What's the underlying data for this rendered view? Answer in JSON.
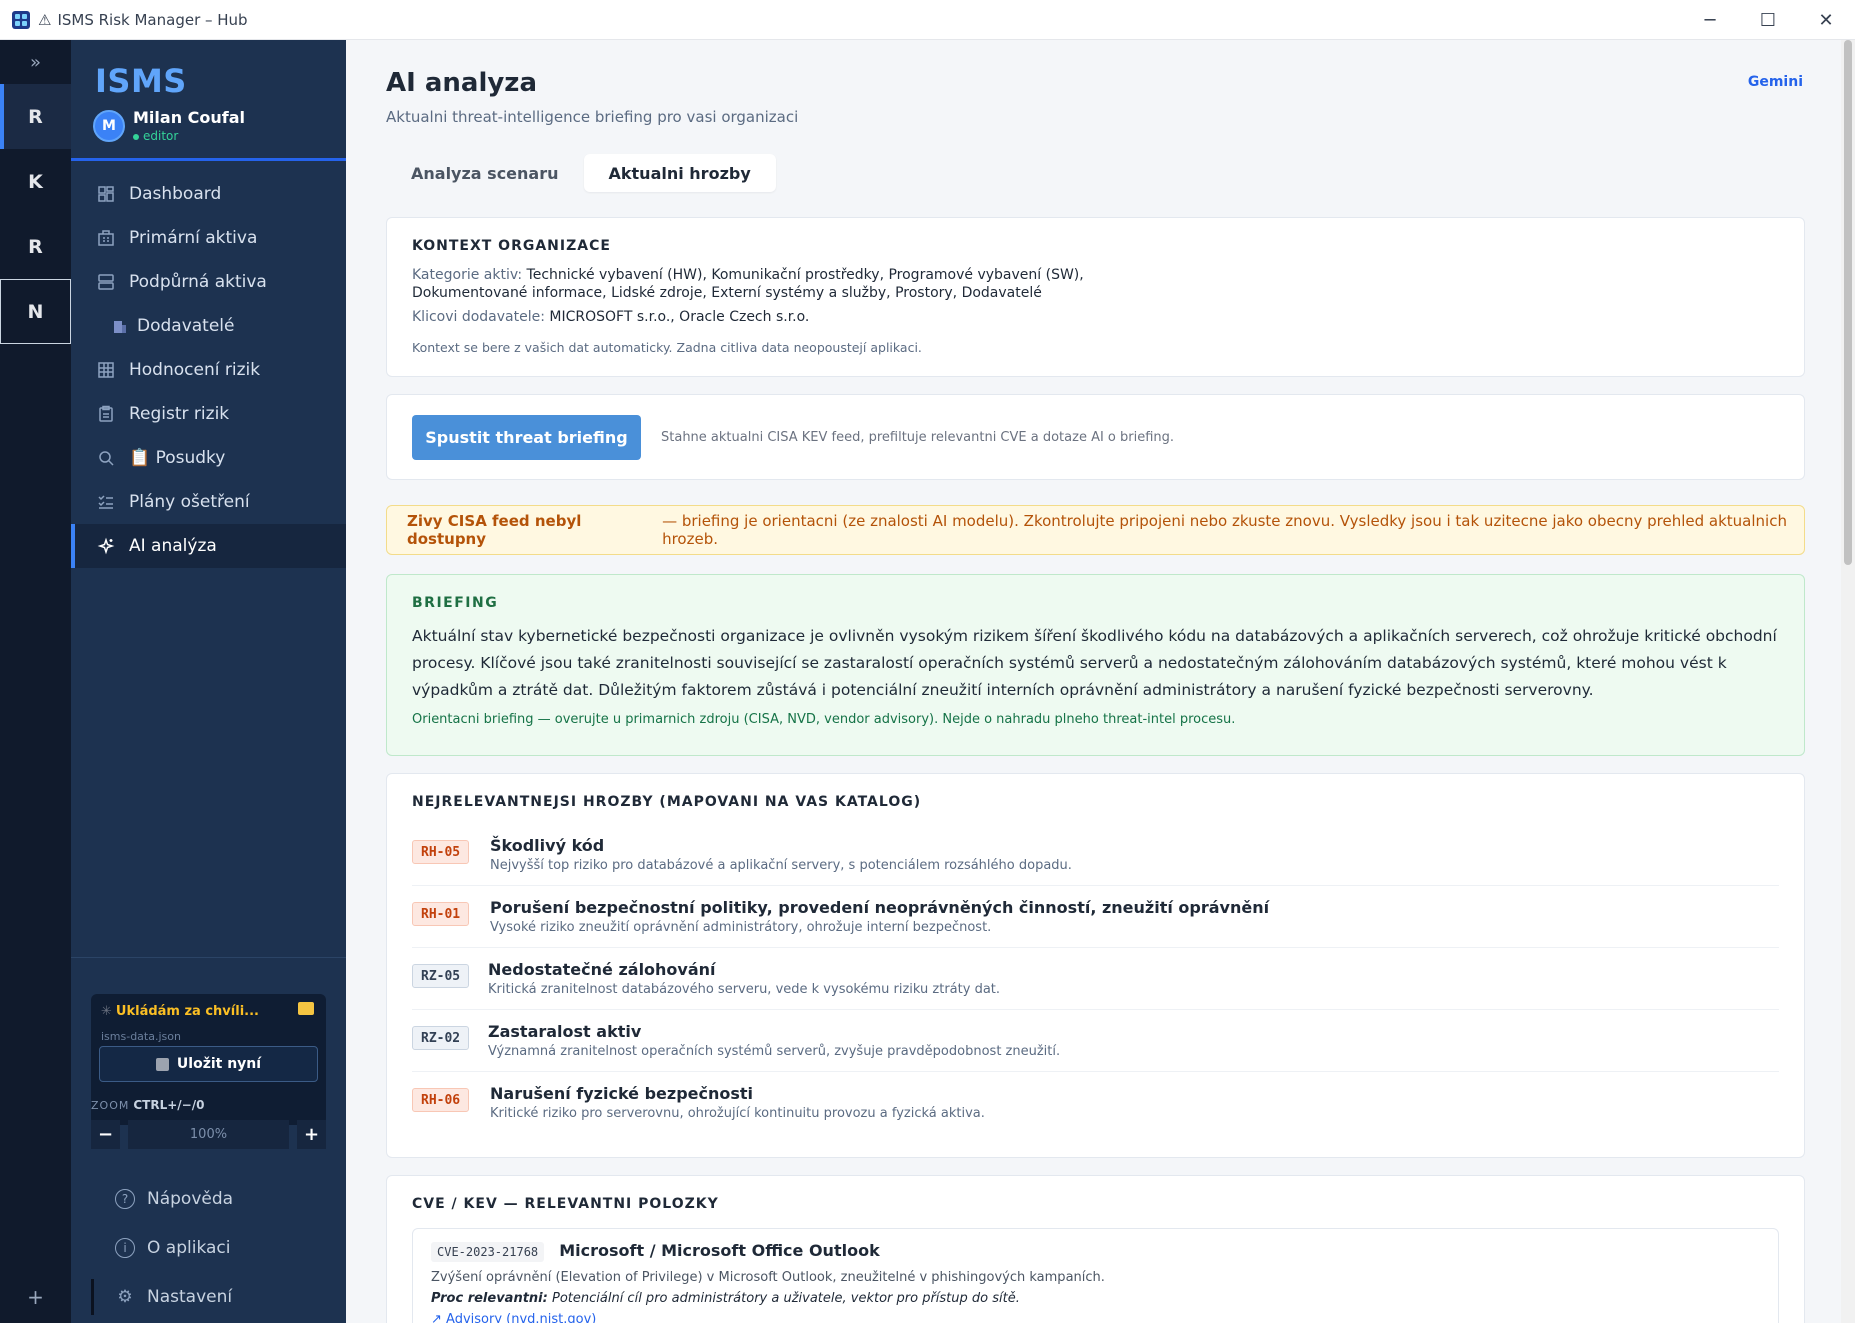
{
  "window": {
    "title": "ISMS Risk Manager – Hub",
    "minimize": "─",
    "maximize": "☐",
    "close": "✕"
  },
  "rail": {
    "expand": "»",
    "items": [
      "R",
      "K",
      "R",
      "N"
    ],
    "add": "+"
  },
  "sidebar": {
    "logo": "ISMS",
    "user": {
      "initial": "M",
      "name": "Milan Coufal",
      "role": "editor"
    },
    "nav": [
      {
        "label": "Dashboard",
        "icon": "dashboard-icon"
      },
      {
        "label": "Primární aktiva",
        "icon": "building-icon"
      },
      {
        "label": "Podpůrná aktiva",
        "icon": "server-icon"
      },
      {
        "label": "Dodavatelé",
        "icon": "supplier-icon"
      },
      {
        "label": "Hodnocení rizik",
        "icon": "grid-icon"
      },
      {
        "label": "Registr rizik",
        "icon": "clipboard-icon"
      },
      {
        "label": "📋 Posudky",
        "icon": "search-icon"
      },
      {
        "label": "Plány ošetření",
        "icon": "checklist-icon"
      },
      {
        "label": "AI analýza",
        "icon": "sparkle-icon"
      }
    ],
    "save": {
      "status": "Ukládám za chvíli...",
      "file": "isms-data.json",
      "button": "Uložit nyní"
    },
    "zoom": {
      "label": "ZOOM",
      "shortcut": "CTRL+/−/0",
      "value": "100%",
      "minus": "−",
      "plus": "+"
    },
    "bottom": [
      {
        "label": "Nápověda",
        "icon": "help-icon",
        "glyph": "?"
      },
      {
        "label": "O aplikaci",
        "icon": "info-icon",
        "glyph": "i"
      },
      {
        "label": "Nastavení",
        "icon": "gear-icon",
        "glyph": "⚙"
      }
    ]
  },
  "main": {
    "title": "AI analyza",
    "subtitle": "Aktualni threat-intelligence briefing pro vasi organizaci",
    "provider": "Gemini",
    "tabs": [
      "Analyza scenaru",
      "Aktualni hrozby"
    ],
    "context": {
      "heading": "KONTEXT ORGANIZACE",
      "categories_label": "Kategorie aktiv:",
      "categories_line1": "Technické vybavení (HW), Komunikační prostředky, Programové vybavení (SW),",
      "categories_line2": "Dokumentované informace, Lidské zdroje, Externí systémy a služby, Prostory, Dodavatelé",
      "suppliers_label": "Klicovi dodavatele:",
      "suppliers": "MICROSOFT s.r.o., Oracle Czech s.r.o.",
      "note": "Kontext se bere z vašich dat automaticky. Zadna citliva data neopoustejí aplikaci."
    },
    "run": {
      "button": "Spustit threat briefing",
      "hint": "Stahne aktualni CISA KEV feed, prefiltuje relevantni CVE a dotaze AI o briefing."
    },
    "warning": {
      "bold": "Zivy CISA feed nebyl dostupny",
      "text": "— briefing je orientacni (ze znalosti AI modelu). Zkontrolujte pripojeni nebo zkuste znovu. Vysledky jsou i tak uzitecne jako obecny prehled aktualnich hrozeb."
    },
    "briefing": {
      "heading": "BRIEFING",
      "text": "Aktuální stav kybernetické bezpečnosti organizace je ovlivněn vysokým rizikem šíření škodlivého kódu na databázových a aplikačních serverech, což ohrožuje kritické obchodní procesy. Klíčové jsou také zranitelnosti související se zastaralostí operačních systémů serverů a nedostatečným zálohováním databázových systémů, které mohou vést k výpadkům a ztrátě dat. Důležitým faktorem zůstává i potenciální zneužití interních oprávnění administrátory a narušení fyzické bezpečnosti serverovny.",
      "disclaimer": "Orientacni briefing — overujte u primarnich zdroju (CISA, NVD, vendor advisory). Nejde o nahradu plneho threat-intel procesu."
    },
    "threats": {
      "heading": "NEJRELEVANTNEJSI HROZBY (MAPOVANI NA VAS KATALOG)",
      "items": [
        {
          "code": "RH-05",
          "title": "Škodlivý kód",
          "desc": "Nejvyšší top riziko pro databázové a aplikační servery, s potenciálem rozsáhlého dopadu."
        },
        {
          "code": "RH-01",
          "title": "Porušení bezpečnostní politiky, provedení neoprávněných činností, zneužití oprávnění",
          "desc": "Vysoké riziko zneužití oprávnění administrátory, ohrožuje interní bezpečnost."
        },
        {
          "code": "RZ-05",
          "title": "Nedostatečné zálohování",
          "desc": "Kritická zranitelnost databázového serveru, vede k vysokému riziku ztráty dat."
        },
        {
          "code": "RZ-02",
          "title": "Zastaralost aktiv",
          "desc": "Významná zranitelnost operačních systémů serverů, zvyšuje pravděpodobnost zneužití."
        },
        {
          "code": "RH-06",
          "title": "Narušení fyzické bezpečnosti",
          "desc": "Kritické riziko pro serverovnu, ohrožující kontinuitu provozu a fyzická aktiva."
        }
      ]
    },
    "cve": {
      "heading": "CVE / KEV — RELEVANTNI POLOZKY",
      "item": {
        "id": "CVE-2023-21768",
        "title": "Microsoft / Microsoft Office Outlook",
        "desc": "Zvýšení oprávnění (Elevation of Privilege) v Microsoft Outlook, zneužitelné v phishingových kampaních.",
        "reason_label": "Proc relevantni:",
        "reason": "Potenciální cíl pro administrátory a uživatele, vektor pro přístup do sítě.",
        "link": "Advisory (nvd.nist.gov)"
      }
    }
  }
}
